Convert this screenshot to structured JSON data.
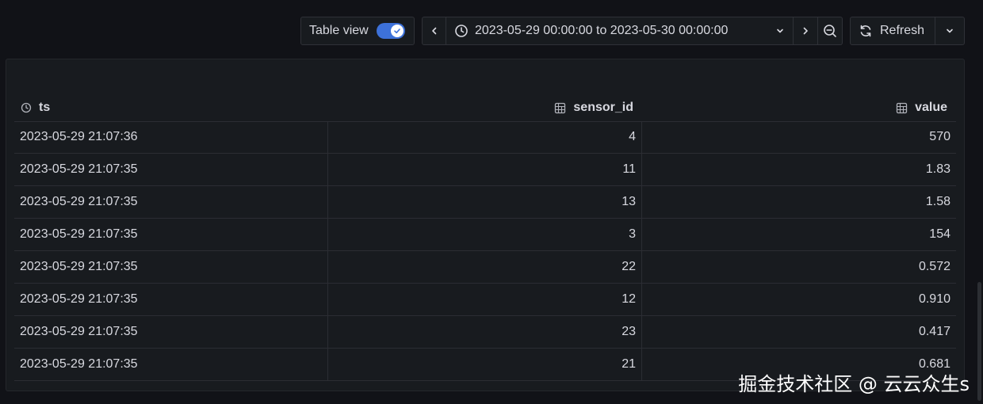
{
  "toolbar": {
    "table_view_label": "Table view",
    "table_view_enabled": true,
    "time_range": "2023-05-29 00:00:00 to 2023-05-30 00:00:00",
    "refresh_label": "Refresh"
  },
  "table": {
    "columns": [
      {
        "label": "ts",
        "icon": "clock-icon"
      },
      {
        "label": "sensor_id",
        "icon": "table-icon"
      },
      {
        "label": "value",
        "icon": "table-icon"
      }
    ],
    "rows": [
      {
        "ts": "2023-05-29 21:07:36",
        "sensor_id": "4",
        "value": "570"
      },
      {
        "ts": "2023-05-29 21:07:35",
        "sensor_id": "11",
        "value": "1.83"
      },
      {
        "ts": "2023-05-29 21:07:35",
        "sensor_id": "13",
        "value": "1.58"
      },
      {
        "ts": "2023-05-29 21:07:35",
        "sensor_id": "3",
        "value": "154"
      },
      {
        "ts": "2023-05-29 21:07:35",
        "sensor_id": "22",
        "value": "0.572"
      },
      {
        "ts": "2023-05-29 21:07:35",
        "sensor_id": "12",
        "value": "0.910"
      },
      {
        "ts": "2023-05-29 21:07:35",
        "sensor_id": "23",
        "value": "0.417"
      },
      {
        "ts": "2023-05-29 21:07:35",
        "sensor_id": "21",
        "value": "0.681"
      }
    ]
  },
  "watermark": "掘金技术社区 @ 云云众生s",
  "colors": {
    "background": "#111217",
    "panel": "#181b1f",
    "accent": "#3d71d9",
    "text": "#d8d9e0"
  }
}
